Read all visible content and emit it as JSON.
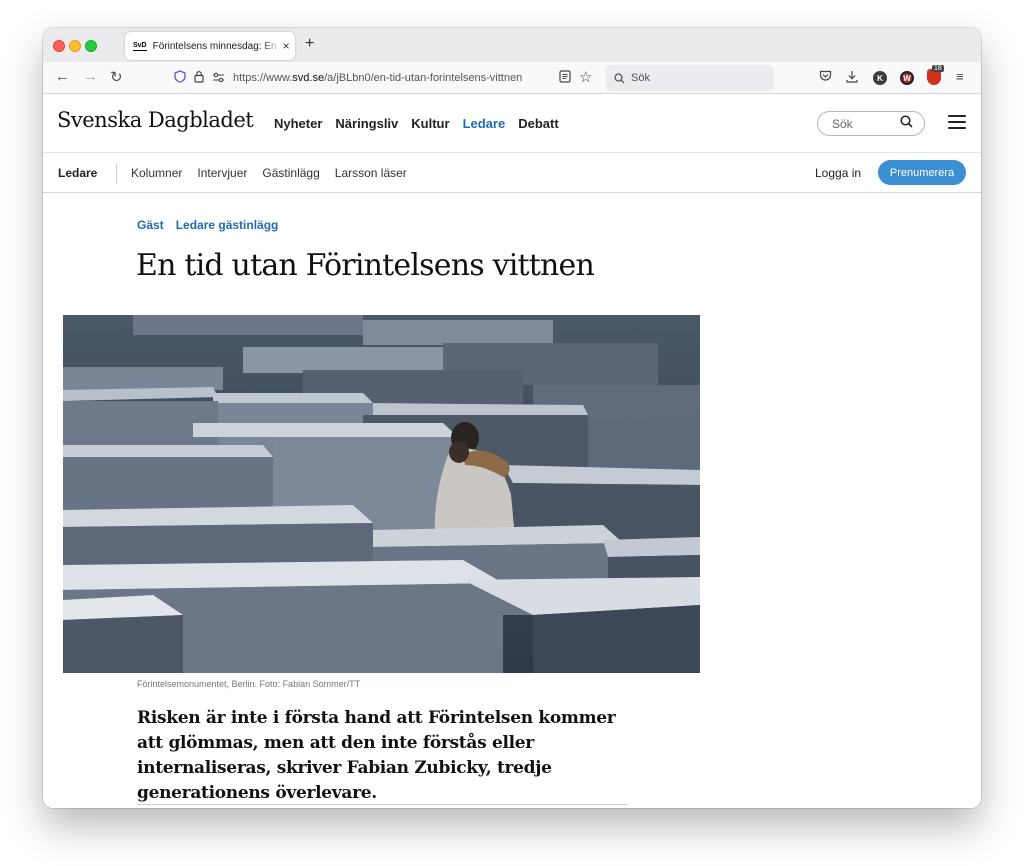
{
  "browser": {
    "tab": {
      "favicon": "SvD",
      "title": "Förintelsens minnesdag: En tid utan Förintelsens vittnen",
      "close": "×"
    },
    "new_tab": "+",
    "nav": {
      "back": "←",
      "forward": "→",
      "reload": "↻"
    },
    "url": {
      "prefix": "https://www.",
      "domain": "svd.se",
      "path": "/a/jBLbn0/en-tid-utan-forintelsens-vittnen"
    },
    "search_placeholder": "Sök",
    "extension_badge_count": "18"
  },
  "site": {
    "logo": "Svenska Dagbladet",
    "nav": [
      {
        "label": "Nyheter",
        "active": false
      },
      {
        "label": "Näringsliv",
        "active": false
      },
      {
        "label": "Kultur",
        "active": false
      },
      {
        "label": "Ledare",
        "active": true
      },
      {
        "label": "Debatt",
        "active": false
      }
    ],
    "search_placeholder": "Sök",
    "sub_nav": {
      "section": "Ledare",
      "links": [
        "Kolumner",
        "Intervjuer",
        "Gästinlägg",
        "Larsson läser"
      ],
      "login": "Logga in",
      "subscribe": "Prenumerera"
    }
  },
  "article": {
    "kicker": [
      "Gäst",
      "Ledare gästinlägg"
    ],
    "headline": "En tid utan Förintelsens vittnen",
    "caption": "Förintelsemonumentet, Berlin. Foto: Fabian Sommer/TT",
    "lead": "Risken är inte i första hand att Förintelsen kommer att glömmas, men att den inte förstås eller internaliseras, skriver Fabian Zubicky, tredje generationens överlevare."
  },
  "colors": {
    "accent": "#1f6db0",
    "subscribe": "#3d8fd3"
  },
  "icons": [
    "shield-icon",
    "lock-icon",
    "permissions-icon",
    "reader-view-icon",
    "bookmark-star-icon",
    "search-icon",
    "pocket-icon",
    "download-icon",
    "account-icon",
    "hamburger-menu-icon"
  ]
}
